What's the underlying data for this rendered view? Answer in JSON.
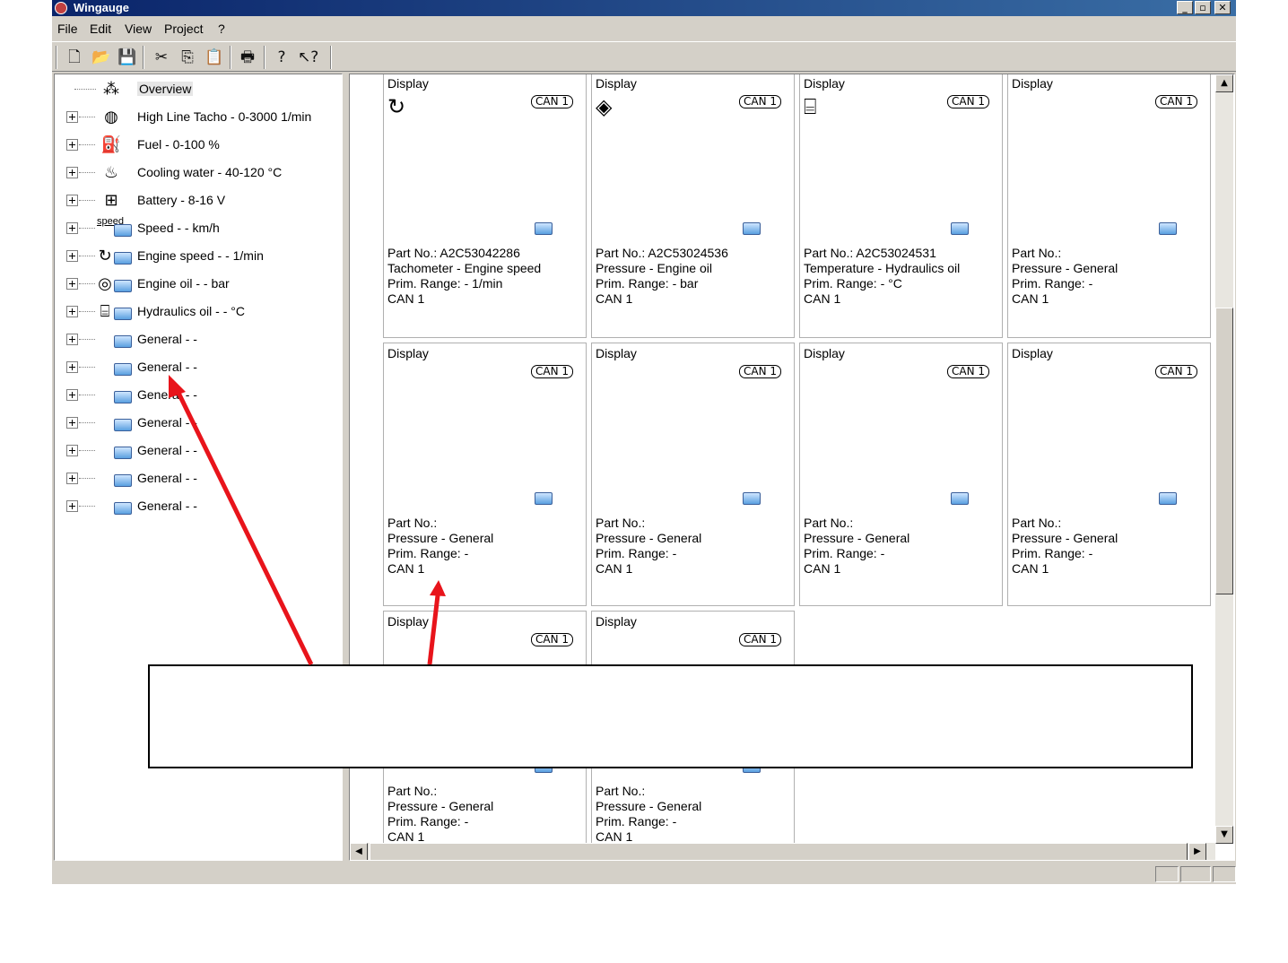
{
  "window": {
    "title": "Wingauge",
    "controls": [
      "_",
      "▫",
      "✕"
    ]
  },
  "menu": [
    "File",
    "Edit",
    "View",
    "Project",
    "?"
  ],
  "toolbar": {
    "icons": [
      "new-file-icon",
      "open-folder-icon",
      "save-icon",
      "cut-icon",
      "copy-icon",
      "paste-icon",
      "print-icon",
      "help-icon",
      "context-help-icon"
    ]
  },
  "tree": {
    "items": [
      {
        "label": "Overview",
        "icon": "overview-icon"
      },
      {
        "label": "High Line Tacho - 0-3000 1/min",
        "icon": "tacho-gauge-icon"
      },
      {
        "label": "Fuel - 0-100 %",
        "icon": "fuel-pump-icon"
      },
      {
        "label": "Cooling water - 40-120 °C",
        "icon": "cooling-water-icon"
      },
      {
        "label": "Battery - 8-16 V",
        "icon": "battery-icon"
      },
      {
        "label": "Speed - - km/h",
        "icon": "speed-icon",
        "icon_text": "speed"
      },
      {
        "label": "Engine speed - - 1/min",
        "icon": "engine-speed-icon"
      },
      {
        "label": "Engine oil - - bar",
        "icon": "engine-oil-icon"
      },
      {
        "label": "Hydraulics oil - - °C",
        "icon": "hydraulics-oil-icon"
      },
      {
        "label": "General - -",
        "icon": "display-icon"
      },
      {
        "label": "General - -",
        "icon": "display-icon"
      },
      {
        "label": "General - -",
        "icon": "display-icon"
      },
      {
        "label": "General - -",
        "icon": "display-icon"
      },
      {
        "label": "General - -",
        "icon": "display-icon"
      },
      {
        "label": "General - -",
        "icon": "display-icon"
      },
      {
        "label": "General - -",
        "icon": "display-icon"
      }
    ]
  },
  "cards": [
    {
      "title": "Display",
      "can": "CAN 1",
      "icon": "rotation-icon",
      "part": "Part No.: A2C53042286",
      "type": "Tachometer - Engine speed",
      "range": "Prim. Range: - 1/min",
      "bus": "CAN 1"
    },
    {
      "title": "Display",
      "can": "CAN 1",
      "icon": "oil-can-icon",
      "part": "Part No.: A2C53024536",
      "type": "Pressure - Engine oil",
      "range": "Prim. Range: - bar",
      "bus": "CAN 1"
    },
    {
      "title": "Display",
      "can": "CAN 1",
      "icon": "hydraulic-temp-icon",
      "part": "Part No.: A2C53024531",
      "type": "Temperature - Hydraulics oil",
      "range": "Prim. Range: - °C",
      "bus": "CAN 1"
    },
    {
      "title": "Display",
      "can": "CAN 1",
      "icon": "",
      "part": "Part No.:",
      "type": "Pressure - General",
      "range": "Prim. Range: -",
      "bus": "CAN 1"
    },
    {
      "title": "Display",
      "can": "CAN 1",
      "icon": "",
      "part": "Part No.:",
      "type": "Pressure - General",
      "range": "Prim. Range: -",
      "bus": "CAN 1"
    },
    {
      "title": "Display",
      "can": "CAN 1",
      "icon": "",
      "part": "Part No.:",
      "type": "Pressure - General",
      "range": "Prim. Range: -",
      "bus": "CAN 1"
    },
    {
      "title": "Display",
      "can": "CAN 1",
      "icon": "",
      "part": "Part No.:",
      "type": "Pressure - General",
      "range": "Prim. Range: -",
      "bus": "CAN 1"
    },
    {
      "title": "Display",
      "can": "CAN 1",
      "icon": "",
      "part": "Part No.:",
      "type": "Pressure - General",
      "range": "Prim. Range: -",
      "bus": "CAN 1"
    },
    {
      "title": "Display",
      "can": "CAN 1",
      "icon": "",
      "part": "Part No.:",
      "type": "Pressure - General",
      "range": "Prim. Range: -",
      "bus": "CAN 1"
    },
    {
      "title": "Display",
      "can": "CAN 1",
      "icon": "",
      "part": "Part No.:",
      "type": "Pressure - General",
      "range": "Prim. Range: -",
      "bus": "CAN 1"
    }
  ],
  "annotation": {
    "color": "#e8141b"
  }
}
